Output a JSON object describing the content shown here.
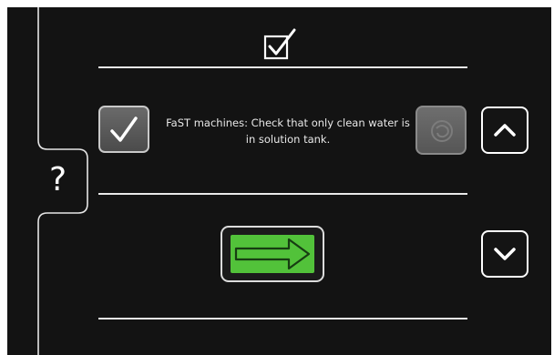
{
  "help": {
    "label": "?",
    "icon": "question-mark-icon"
  },
  "step": {
    "header_icon": "checkbox-checked-icon",
    "confirm_icon": "checkmark-icon",
    "instruction": "FaST machines: Check that only clean water is in solution tank.",
    "disabled_icon": "swirl-icon",
    "scroll_up_icon": "chevron-up-icon",
    "scroll_down_icon": "chevron-down-icon",
    "next_icon": "arrow-right-icon"
  },
  "colors": {
    "background": "#131313",
    "next_button_fill": "#52c23a",
    "divider": "#e9e9e9"
  }
}
